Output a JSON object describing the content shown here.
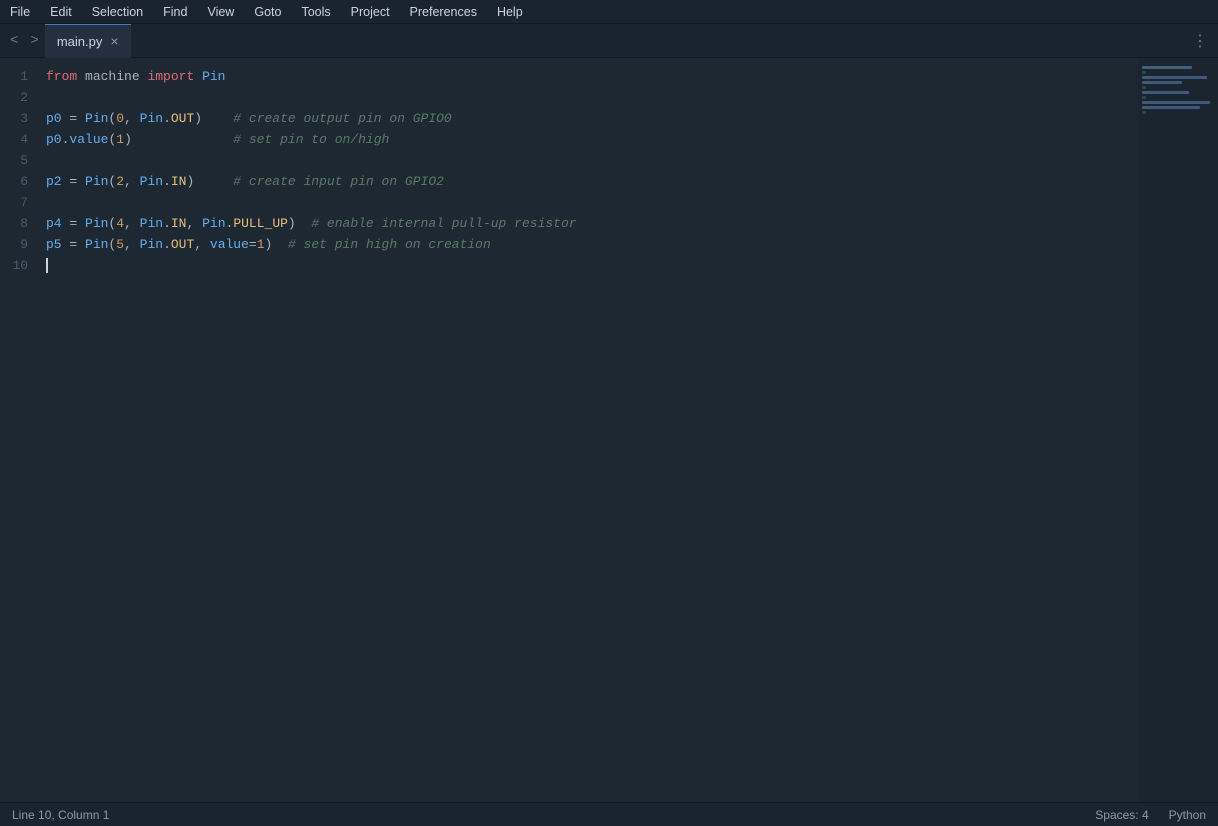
{
  "menubar": {
    "items": [
      "File",
      "Edit",
      "Selection",
      "Find",
      "View",
      "Goto",
      "Tools",
      "Project",
      "Preferences",
      "Help"
    ]
  },
  "tabbar": {
    "nav_back": "<",
    "nav_fwd": ">",
    "tab_filename": "main.py",
    "tab_close": "×",
    "more_icon": "⋮"
  },
  "code": {
    "lines": [
      {
        "num": 1,
        "content": "from machine import Pin"
      },
      {
        "num": 2,
        "content": ""
      },
      {
        "num": 3,
        "content": "p0 = Pin(0, Pin.OUT)    # create output pin on GPIO0"
      },
      {
        "num": 4,
        "content": "p0.value(1)             # set pin to on/high"
      },
      {
        "num": 5,
        "content": ""
      },
      {
        "num": 6,
        "content": "p2 = Pin(2, Pin.IN)     # create input pin on GPIO2"
      },
      {
        "num": 7,
        "content": ""
      },
      {
        "num": 8,
        "content": "p4 = Pin(4, Pin.IN, Pin.PULL_UP)  # enable internal pull-up resistor"
      },
      {
        "num": 9,
        "content": "p5 = Pin(5, Pin.OUT, value=1)  # set pin high on creation"
      },
      {
        "num": 10,
        "content": ""
      }
    ]
  },
  "statusbar": {
    "position": "Line 10, Column 1",
    "spaces": "Spaces: 4",
    "language": "Python"
  }
}
